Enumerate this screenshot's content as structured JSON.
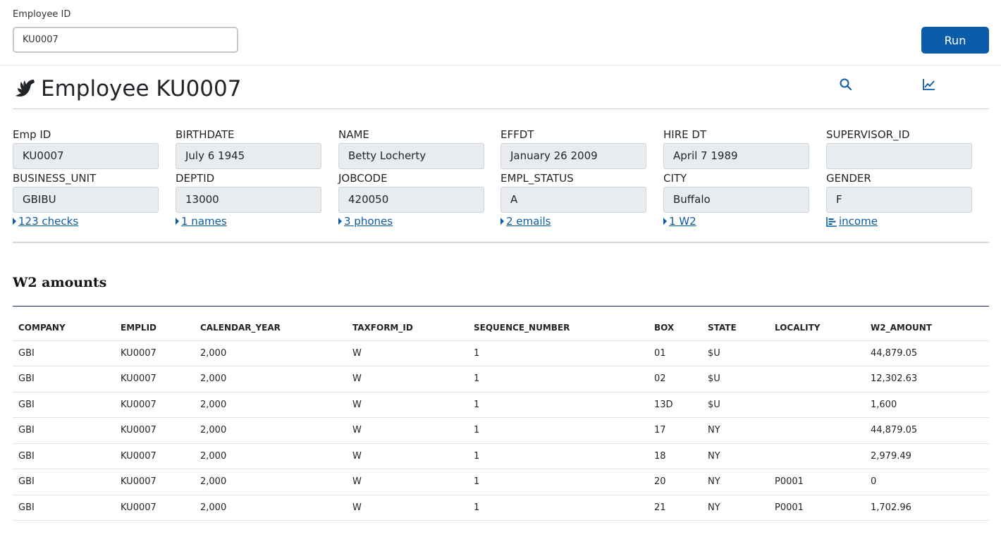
{
  "params": {
    "label": "Employee ID",
    "value": "KU0007",
    "run_label": "Run"
  },
  "header": {
    "title": "Employee KU0007",
    "icons": [
      "bird-icon",
      "search-icon",
      "chart-line-icon"
    ]
  },
  "fields": [
    {
      "label": "Emp ID",
      "value": "KU0007"
    },
    {
      "label": "BIRTHDATE",
      "value": "July 6 1945"
    },
    {
      "label": "NAME",
      "value": "Betty Locherty"
    },
    {
      "label": "EFFDT",
      "value": "January 26 2009"
    },
    {
      "label": "HIRE DT",
      "value": "April 7 1989"
    },
    {
      "label": "SUPERVISOR_ID",
      "value": ""
    },
    {
      "label": "BUSINESS_UNIT",
      "value": "GBIBU"
    },
    {
      "label": "DEPTID",
      "value": "13000"
    },
    {
      "label": "JOBCODE",
      "value": "420050"
    },
    {
      "label": "EMPL_STATUS",
      "value": "A"
    },
    {
      "label": "CITY",
      "value": "Buffalo"
    },
    {
      "label": "GENDER",
      "value": "F"
    }
  ],
  "links": [
    {
      "label": "123 checks",
      "icon": "caret-right-icon"
    },
    {
      "label": "1 names",
      "icon": "caret-right-icon"
    },
    {
      "label": "3 phones",
      "icon": "caret-right-icon"
    },
    {
      "label": "2 emails",
      "icon": "caret-right-icon"
    },
    {
      "label": "1 W2",
      "icon": "caret-right-icon"
    },
    {
      "label": "income",
      "icon": "bar-chart-icon"
    }
  ],
  "section": {
    "title": "W2 amounts"
  },
  "table": {
    "columns": [
      "COMPANY",
      "EMPLID",
      "CALENDAR_YEAR",
      "TAXFORM_ID",
      "SEQUENCE_NUMBER",
      "BOX",
      "STATE",
      "LOCALITY",
      "W2_AMOUNT"
    ],
    "rows": [
      [
        "GBI",
        "KU0007",
        "2,000",
        "W",
        "1",
        "01",
        "$U",
        "",
        "44,879.05"
      ],
      [
        "GBI",
        "KU0007",
        "2,000",
        "W",
        "1",
        "02",
        "$U",
        "",
        "12,302.63"
      ],
      [
        "GBI",
        "KU0007",
        "2,000",
        "W",
        "1",
        "13D",
        "$U",
        "",
        "1,600"
      ],
      [
        "GBI",
        "KU0007",
        "2,000",
        "W",
        "1",
        "17",
        "NY",
        "",
        "44,879.05"
      ],
      [
        "GBI",
        "KU0007",
        "2,000",
        "W",
        "1",
        "18",
        "NY",
        "",
        "2,979.49"
      ],
      [
        "GBI",
        "KU0007",
        "2,000",
        "W",
        "1",
        "20",
        "NY",
        "P0001",
        "0"
      ],
      [
        "GBI",
        "KU0007",
        "2,000",
        "W",
        "1",
        "21",
        "NY",
        "P0001",
        "1,702.96"
      ]
    ]
  },
  "colors": {
    "accent": "#0a5ca8",
    "field_bg": "#e9ecef",
    "section_rule": "#1a237e"
  }
}
